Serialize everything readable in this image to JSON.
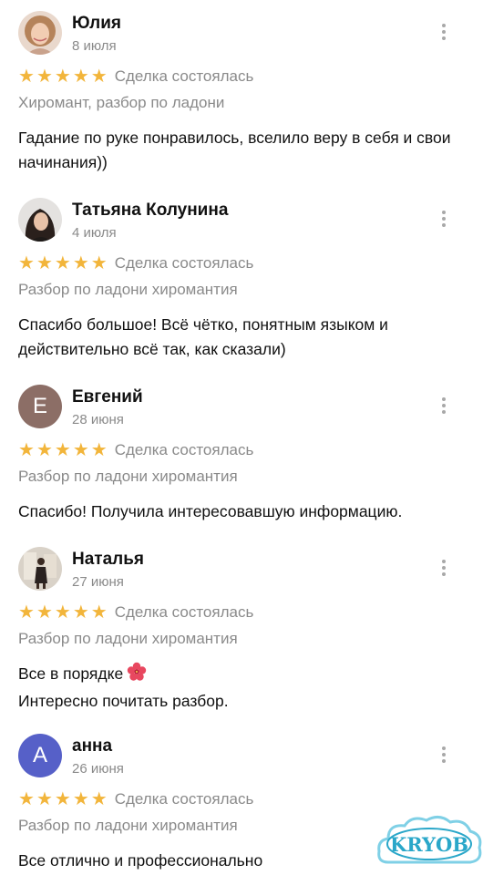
{
  "reviews": [
    {
      "name": "Юлия",
      "date": "8 июля",
      "avatar": {
        "type": "photo",
        "icon": "user-photo-icon"
      },
      "stars": 5,
      "deal_status": "Сделка состоялась",
      "service": "Хиромант, разбор по ладони",
      "text": "Гадание по руке понравилось, вселило веру в себя и свои начинания))"
    },
    {
      "name": "Татьяна Колунина",
      "date": "4 июля",
      "avatar": {
        "type": "photo",
        "icon": "user-photo-icon"
      },
      "stars": 5,
      "deal_status": "Сделка состоялась",
      "service": "Разбор по ладони хиромантия",
      "text": "Спасибо большое! Всё чётко, понятным языком и действительно всё так, как сказали)"
    },
    {
      "name": "Евгений",
      "date": "28 июня",
      "avatar": {
        "type": "letter",
        "letter": "Е",
        "color": "#8c6e66"
      },
      "stars": 5,
      "deal_status": "Сделка состоялась",
      "service": "Разбор по ладони хиромантия",
      "text": "Спасибо! Получила интересовавшую информацию."
    },
    {
      "name": "Наталья",
      "date": "27 июня",
      "avatar": {
        "type": "photo",
        "icon": "user-photo-icon"
      },
      "stars": 5,
      "deal_status": "Сделка состоялась",
      "service": "Разбор по ладони хиромантия",
      "text_line1": "Все в порядке",
      "emoji": "flower-emoji-icon",
      "text_line2": "Интересно почитать разбор."
    },
    {
      "name": "анна",
      "date": "26 июня",
      "avatar": {
        "type": "letter",
        "letter": "А",
        "color": "#5660c8"
      },
      "stars": 5,
      "deal_status": "Сделка состоялась",
      "service": "Разбор по ладони хиромантия",
      "text": "Все отлично и профессионально"
    }
  ],
  "colors": {
    "star": "#f2b53b",
    "secondary_text": "#8a8a8a",
    "more_dots": "#a8a8a8"
  },
  "icons": {
    "star": "star-icon",
    "more": "more-vertical-icon"
  },
  "watermark": {
    "text": "KRYOB",
    "color": "#2aa7c9"
  }
}
